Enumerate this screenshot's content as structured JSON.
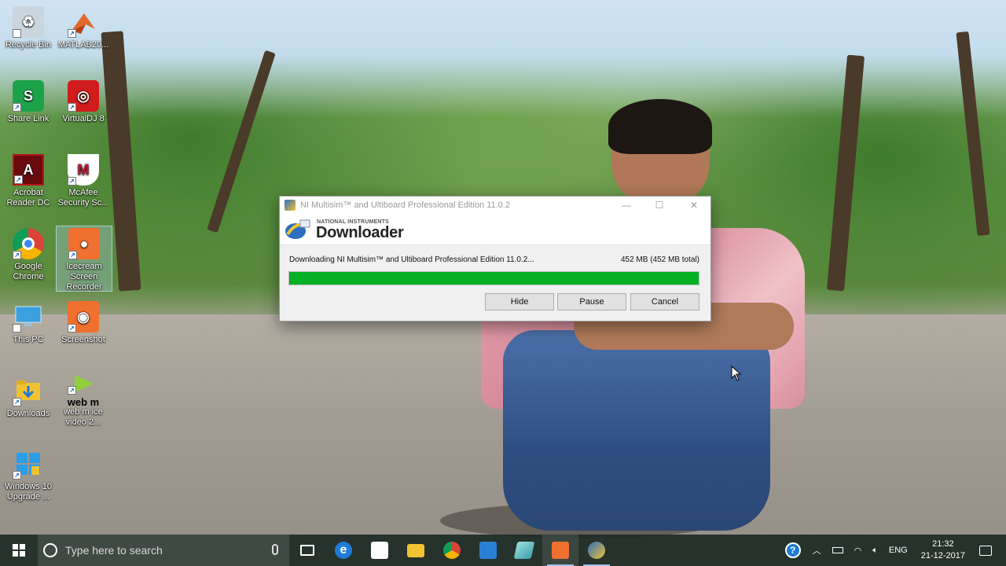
{
  "desktop": {
    "icons": [
      {
        "label": "Recycle Bin",
        "icon": "recycle-bin-icon",
        "color": "#b9c9d6"
      },
      {
        "label": "MATLAB20...",
        "icon": "matlab-icon",
        "color": "#e3692a"
      },
      {
        "label": "Share Link",
        "icon": "share-link-icon",
        "color": "#1ca24a"
      },
      {
        "label": "VirtualDJ 8",
        "icon": "virtualdj-icon",
        "color": "#d11c1c"
      },
      {
        "label": "Acrobat Reader DC",
        "icon": "acrobat-icon",
        "color": "#b8141b"
      },
      {
        "label": "McAfee Security Sc...",
        "icon": "mcafee-icon",
        "color": "#c0162e"
      },
      {
        "label": "Google Chrome",
        "icon": "chrome-icon",
        "color": "#3d8ce8"
      },
      {
        "label": "Icecream Screen Recorder",
        "icon": "icecream-recorder-icon",
        "color": "#f07030"
      },
      {
        "label": "This PC",
        "icon": "this-pc-icon",
        "color": "#3aa0e0"
      },
      {
        "label": "Screenshot",
        "icon": "screenshot-icon",
        "color": "#f07030"
      },
      {
        "label": "Downloads",
        "icon": "downloads-folder-icon",
        "color": "#f1c232"
      },
      {
        "label": "web m ice video 2...",
        "icon": "webm-video-icon",
        "color": "#8fd13c"
      },
      {
        "label": "Windows 10 Upgrade ...",
        "icon": "windows10-upgrade-icon",
        "color": "#2a9fe8"
      }
    ],
    "icecream_label": [
      "Icecream",
      "Screen",
      "Recorder"
    ],
    "webm_big": "web m"
  },
  "dialog": {
    "title": "NI Multisim™ and Ultiboard Professional Edition 11.0.2",
    "brand_small": "NATIONAL INSTRUMENTS",
    "brand_big": "Downloader",
    "status": "Downloading NI Multisim™ and Ultiboard Professional Edition 11.0.2...",
    "size": "452 MB (452 MB total)",
    "progress_percent": 100,
    "progress_color": "#06b025",
    "buttons": {
      "hide": "Hide",
      "pause": "Pause",
      "cancel": "Cancel"
    },
    "window_controls": {
      "minimize": "—",
      "maximize": "☐",
      "close": "✕"
    }
  },
  "taskbar": {
    "search_placeholder": "Type here to search",
    "apps": [
      "task-view",
      "edge",
      "store",
      "file-explorer",
      "chrome",
      "matlab",
      "notepad",
      "icecream-recorder",
      "ni-downloader"
    ],
    "tray": {
      "language": "ENG",
      "time": "21:32",
      "date": "21-12-2017"
    }
  }
}
